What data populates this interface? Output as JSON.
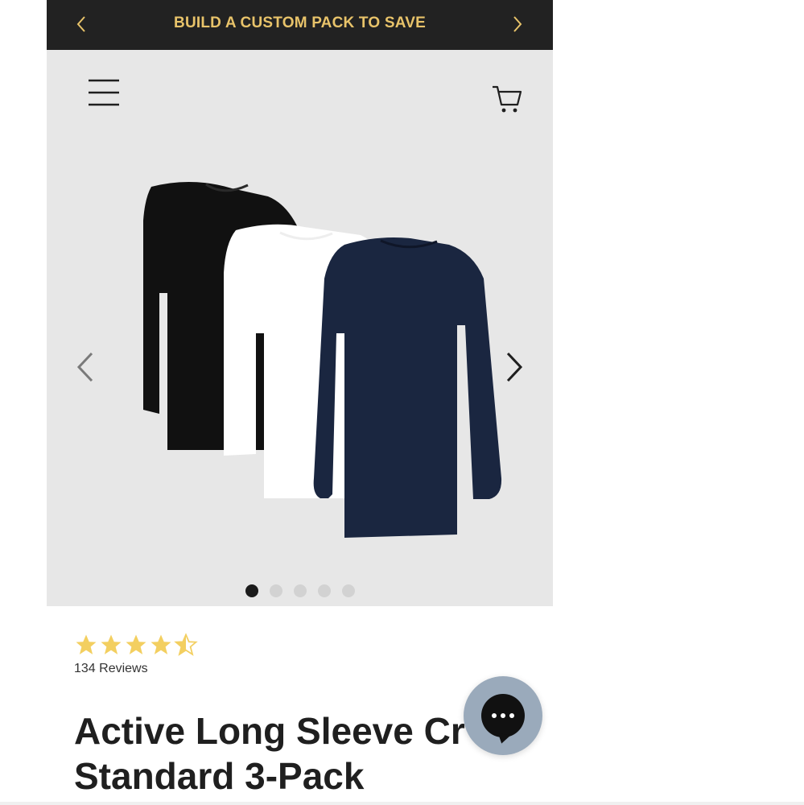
{
  "promo": {
    "text": "BUILD A CUSTOM PACK TO SAVE",
    "prev_icon": "chevron-left-icon",
    "next_icon": "chevron-right-icon",
    "text_color": "#e8c36a",
    "background": "#222222"
  },
  "header": {
    "menu_icon": "hamburger-menu-icon",
    "cart_icon": "shopping-cart-icon"
  },
  "gallery": {
    "prev_icon": "chevron-left-icon",
    "next_icon": "chevron-right-icon",
    "image": "product-image-three-long-sleeve-shirts",
    "shirt_colors": [
      "#111111",
      "#ffffff",
      "#1a2640"
    ],
    "slide_count": 5,
    "active_slide": 1
  },
  "product": {
    "rating": 4.5,
    "rating_max": 5,
    "star_color": "#f3cf60",
    "reviews_label": "134 Reviews",
    "title_line1": "Active Long Sleeve Cr",
    "title_line2": "Standard 3-Pack"
  },
  "chat": {
    "icon": "chat-bubble-icon",
    "background": "#9aaabb"
  }
}
